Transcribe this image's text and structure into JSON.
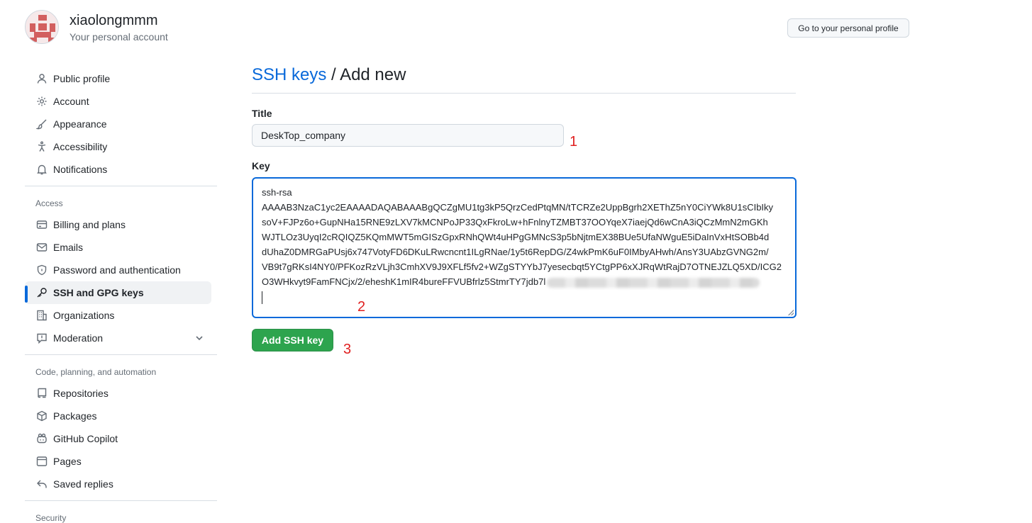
{
  "header": {
    "username": "xiaolongmmm",
    "subtitle": "Your personal account",
    "profile_button": "Go to your personal profile"
  },
  "sidebar": {
    "items": [
      {
        "label": "Public profile",
        "icon": "person-icon"
      },
      {
        "label": "Account",
        "icon": "gear-icon"
      },
      {
        "label": "Appearance",
        "icon": "paintbrush-icon"
      },
      {
        "label": "Accessibility",
        "icon": "accessibility-icon"
      },
      {
        "label": "Notifications",
        "icon": "bell-icon"
      }
    ],
    "access_heading": "Access",
    "access_items": [
      {
        "label": "Billing and plans",
        "icon": "credit-card-icon"
      },
      {
        "label": "Emails",
        "icon": "mail-icon"
      },
      {
        "label": "Password and authentication",
        "icon": "shield-lock-icon"
      },
      {
        "label": "SSH and GPG keys",
        "icon": "key-icon",
        "active": true
      },
      {
        "label": "Organizations",
        "icon": "organization-icon"
      },
      {
        "label": "Moderation",
        "icon": "report-icon"
      }
    ],
    "code_heading": "Code, planning, and automation",
    "code_items": [
      {
        "label": "Repositories",
        "icon": "repo-icon"
      },
      {
        "label": "Packages",
        "icon": "package-icon"
      },
      {
        "label": "GitHub Copilot",
        "icon": "copilot-icon"
      },
      {
        "label": "Pages",
        "icon": "browser-icon"
      },
      {
        "label": "Saved replies",
        "icon": "reply-icon"
      }
    ],
    "security_heading": "Security"
  },
  "main": {
    "breadcrumb_link": "SSH keys",
    "breadcrumb_separator": " / ",
    "page_title": "Add new",
    "title_label": "Title",
    "title_value": "DeskTop_company",
    "key_label": "Key",
    "key_lines": [
      "ssh-rsa",
      "AAAAB3NzaC1yc2EAAAADAQABAAABgQCZgMU1tg3kP5QrzCedPtqMN/tTCRZe2UppBgrh2XEThZ5nY0CiYWk8U1sCIbIky",
      "soV+FJPz6o+GupNHa15RNE9zLXV7kMCNPoJP33QxFkroLw+hFnlnyTZMBT37OOYqeX7iaejQd6wCnA3iQCzMmN2mGKh",
      "WJTLOz3UyqI2cRQIQZ5KQmMWT5mGISzGpxRNhQWt4uHPgGMNcS3p5bNjtmEX38BUe5UfaNWguE5iDaInVxHtSOBb4d",
      "dUhaZ0DMRGaPUsj6x747VotyFD6DKuLRwcncnt1ILgRNae/1y5t6RepDG/Z4wkPmK6uF0IMbyAHwh/AnsY3UAbzGVNG2m/",
      "VB9t7gRKsI4NY0/PFKozRzVLjh3CmhXV9J9XFLf5fv2+WZgSTYYbJ7yesecbqt5YCtgPP6xXJRqWtRajD7OTNEJZLQ5XD/ICG2",
      "O3WHkvyt9FamFNCjx/2/eheshK1mIR4bureFFVUBfrlz5StmrTY7jdb7l"
    ],
    "add_button": "Add SSH key"
  },
  "annotations": [
    "1",
    "2",
    "3"
  ],
  "colors": {
    "accent": "#0969da",
    "primary_button": "#2da44e",
    "annotation": "#e02020"
  }
}
